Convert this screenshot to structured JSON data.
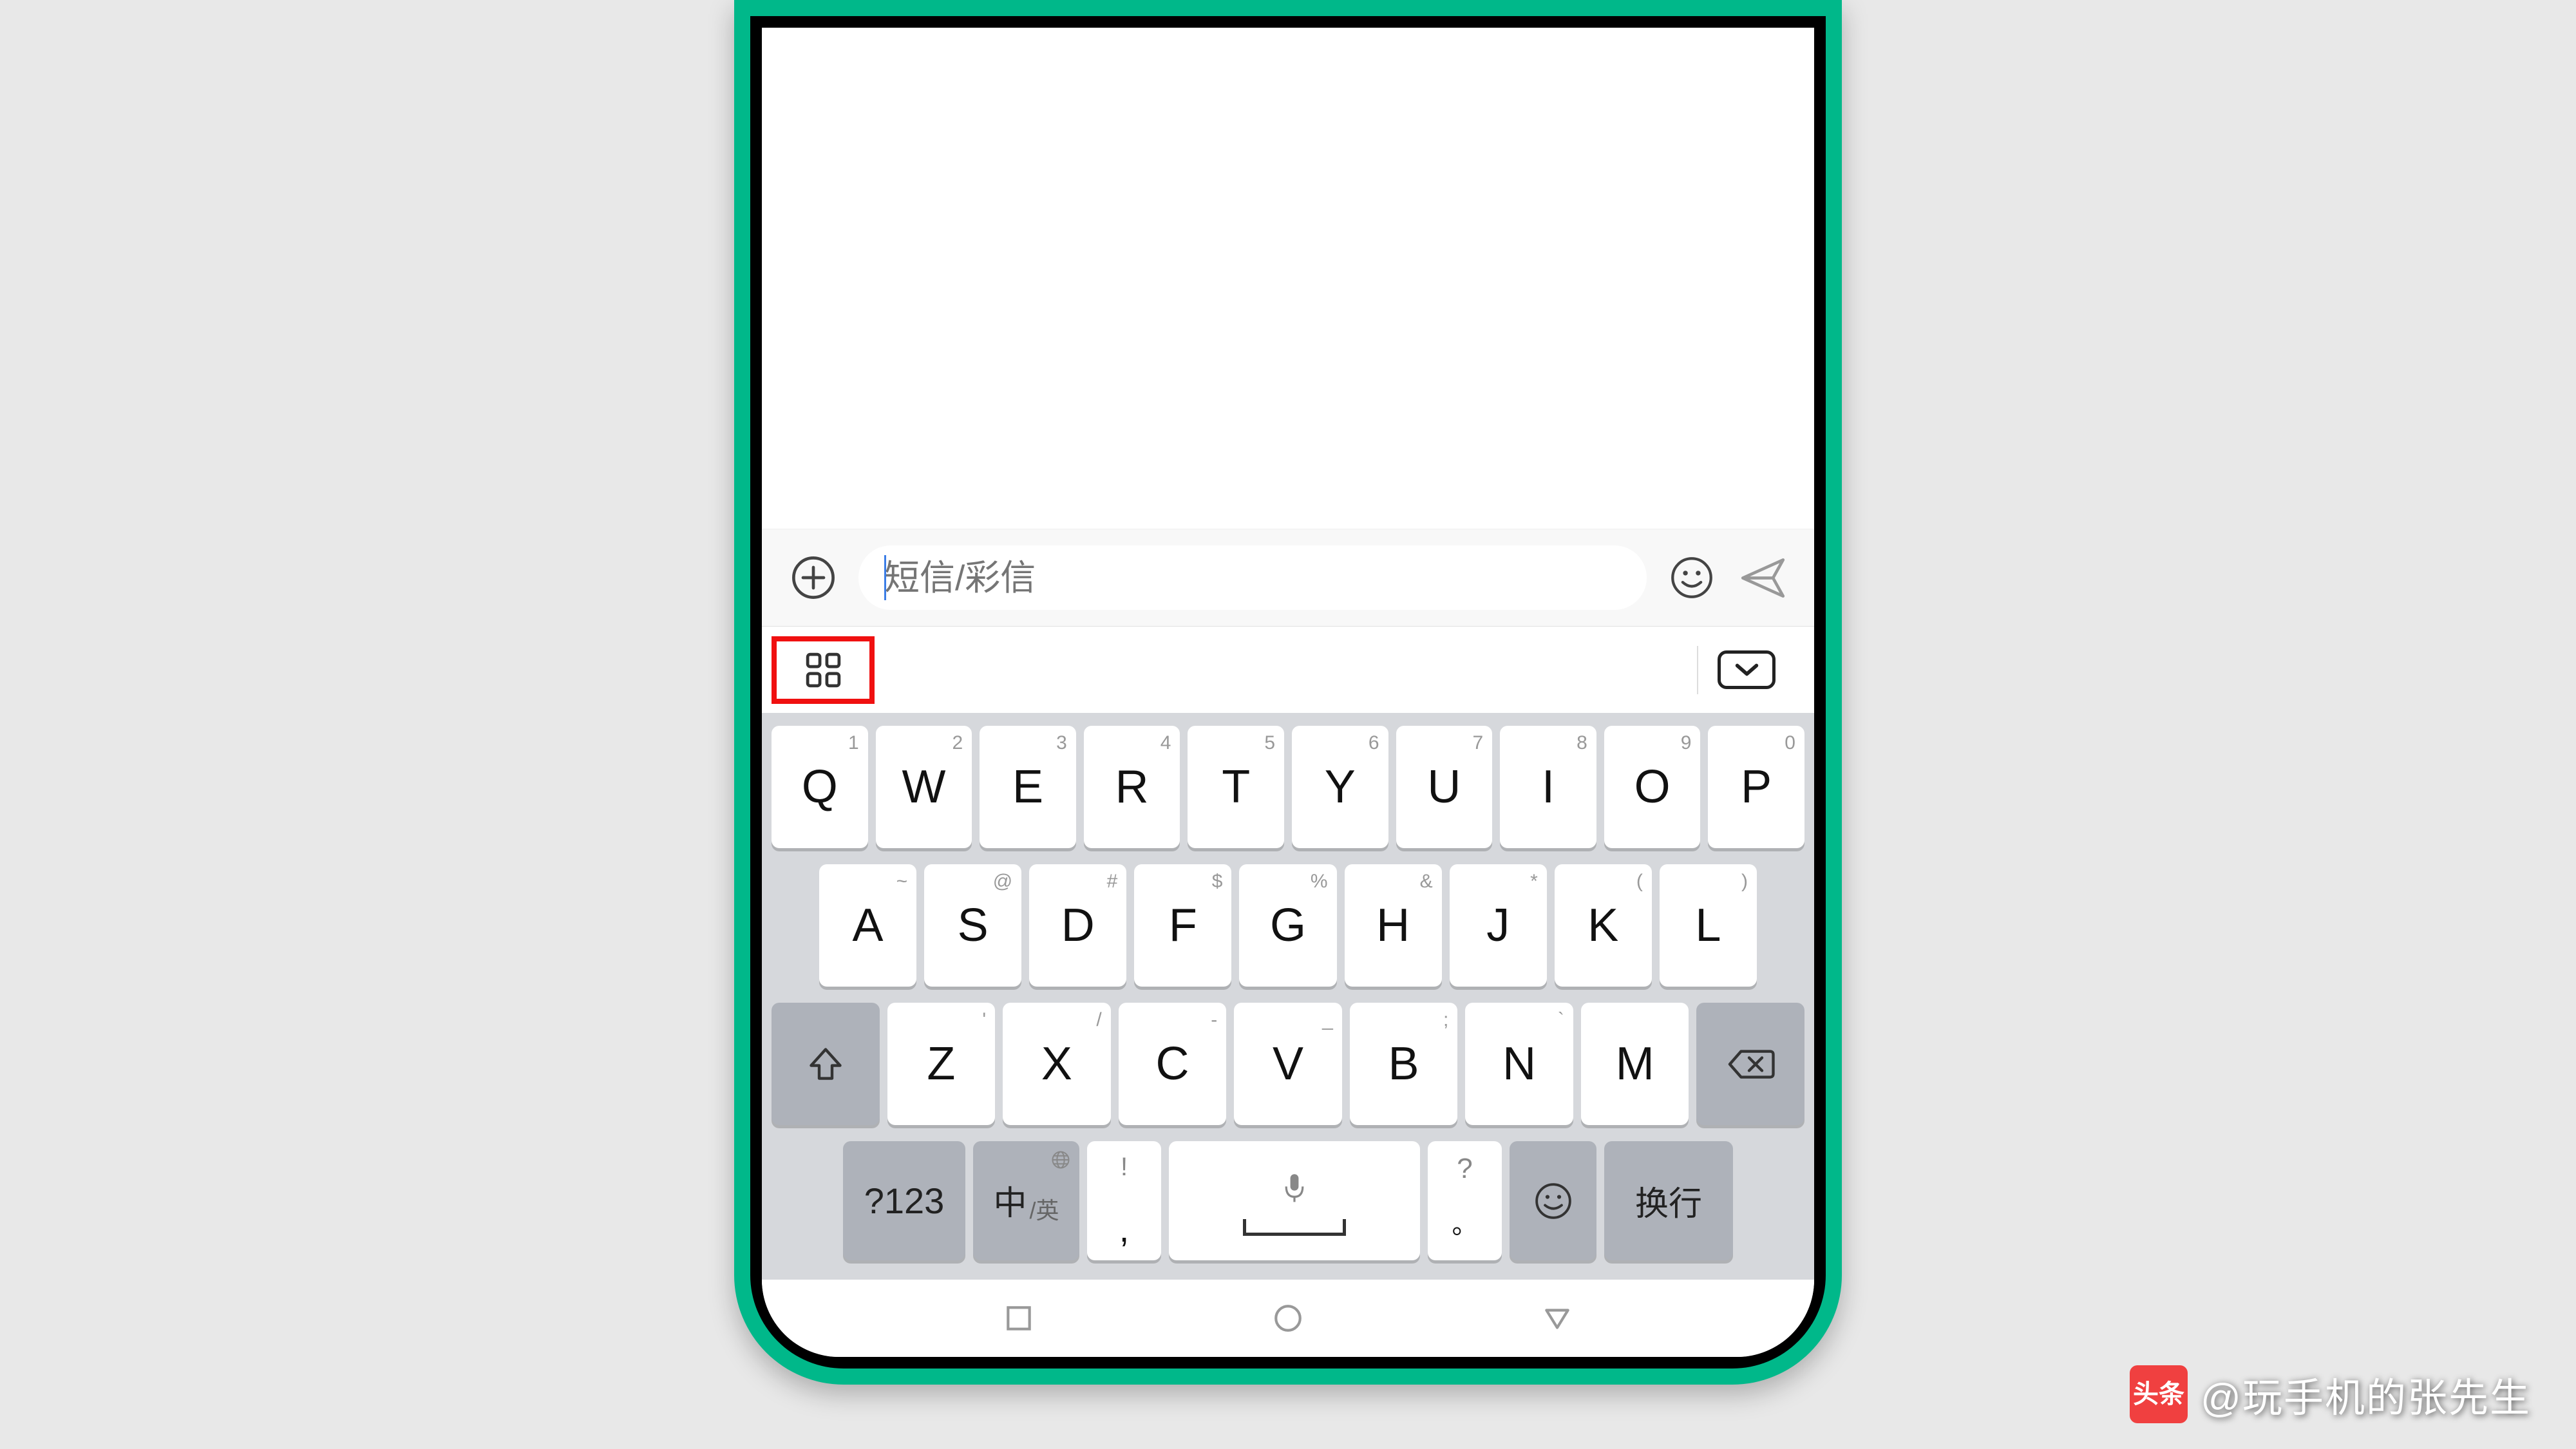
{
  "message_bar": {
    "placeholder": "短信/彩信"
  },
  "keyboard": {
    "row1": [
      {
        "main": "Q",
        "alt": "1"
      },
      {
        "main": "W",
        "alt": "2"
      },
      {
        "main": "E",
        "alt": "3"
      },
      {
        "main": "R",
        "alt": "4"
      },
      {
        "main": "T",
        "alt": "5"
      },
      {
        "main": "Y",
        "alt": "6"
      },
      {
        "main": "U",
        "alt": "7"
      },
      {
        "main": "I",
        "alt": "8"
      },
      {
        "main": "O",
        "alt": "9"
      },
      {
        "main": "P",
        "alt": "0"
      }
    ],
    "row2": [
      {
        "main": "A",
        "alt": "~"
      },
      {
        "main": "S",
        "alt": "@"
      },
      {
        "main": "D",
        "alt": "#"
      },
      {
        "main": "F",
        "alt": "$"
      },
      {
        "main": "G",
        "alt": "%"
      },
      {
        "main": "H",
        "alt": "&"
      },
      {
        "main": "J",
        "alt": "*"
      },
      {
        "main": "K",
        "alt": "("
      },
      {
        "main": "L",
        "alt": ")"
      }
    ],
    "row3": [
      {
        "main": "Z",
        "alt": "'"
      },
      {
        "main": "X",
        "alt": "/"
      },
      {
        "main": "C",
        "alt": "-"
      },
      {
        "main": "V",
        "alt": "_"
      },
      {
        "main": "B",
        "alt": ";"
      },
      {
        "main": "N",
        "alt": "`"
      },
      {
        "main": "M",
        "alt": ""
      }
    ],
    "mode_label": "?123",
    "lang_main": "中",
    "lang_sub": "/英",
    "comma_alt": "!",
    "comma_main": ",",
    "period_alt": "?",
    "period_main": "。",
    "enter_label": "换行"
  },
  "watermark": {
    "logo": "头条",
    "text": "@玩手机的张先生"
  }
}
